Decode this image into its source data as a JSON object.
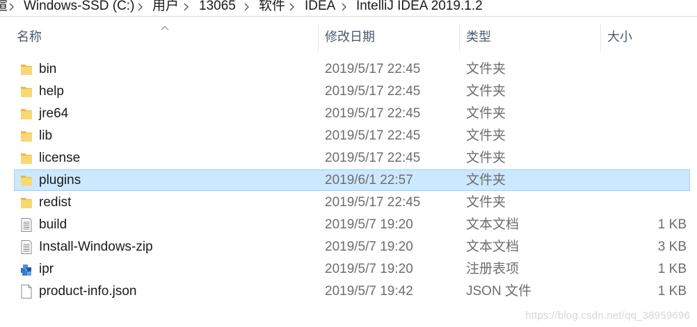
{
  "breadcrumb": {
    "items": [
      "瑄",
      "Windows-SSD (C:)",
      "用户",
      "13065",
      "软件",
      "IDEA",
      "IntelliJ IDEA 2019.1.2"
    ]
  },
  "columns": {
    "name": "名称",
    "date": "修改日期",
    "type": "类型",
    "size": "大小"
  },
  "files": [
    {
      "name": "bin",
      "date": "2019/5/17 22:45",
      "type": "文件夹",
      "size": "",
      "icon": "folder-icon"
    },
    {
      "name": "help",
      "date": "2019/5/17 22:45",
      "type": "文件夹",
      "size": "",
      "icon": "folder-icon"
    },
    {
      "name": "jre64",
      "date": "2019/5/17 22:45",
      "type": "文件夹",
      "size": "",
      "icon": "folder-icon"
    },
    {
      "name": "lib",
      "date": "2019/5/17 22:45",
      "type": "文件夹",
      "size": "",
      "icon": "folder-icon"
    },
    {
      "name": "license",
      "date": "2019/5/17 22:45",
      "type": "文件夹",
      "size": "",
      "icon": "folder-icon"
    },
    {
      "name": "plugins",
      "date": "2019/6/1 22:57",
      "type": "文件夹",
      "size": "",
      "icon": "folder-icon",
      "selected": true
    },
    {
      "name": "redist",
      "date": "2019/5/17 22:45",
      "type": "文件夹",
      "size": "",
      "icon": "folder-icon"
    },
    {
      "name": "build",
      "date": "2019/5/7 19:20",
      "type": "文本文档",
      "size": "1 KB",
      "icon": "text-document-icon"
    },
    {
      "name": "Install-Windows-zip",
      "date": "2019/5/7 19:20",
      "type": "文本文档",
      "size": "3 KB",
      "icon": "text-document-icon"
    },
    {
      "name": "ipr",
      "date": "2019/5/7 19:20",
      "type": "注册表项",
      "size": "1 KB",
      "icon": "registry-file-icon"
    },
    {
      "name": "product-info.json",
      "date": "2019/5/7 19:42",
      "type": "JSON 文件",
      "size": "1 KB",
      "icon": "blank-file-icon"
    }
  ],
  "watermark": "https://blog.csdn.net/qq_38959696",
  "colors": {
    "selection_bg": "#cce8ff",
    "selection_border": "#99d1ff",
    "folder": "#f8d775",
    "header_text": "#4d5a6b"
  }
}
